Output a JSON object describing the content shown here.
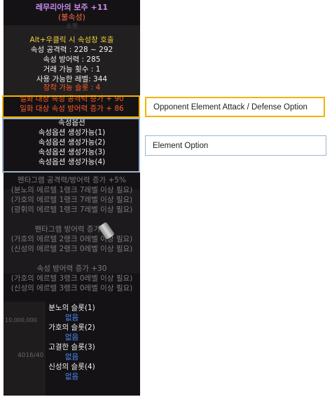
{
  "tooltip": {
    "name": "레무리아의 보주 +11",
    "element": "(불속성)",
    "slot_label": "소켓",
    "hint": "Alt+우클릭 시 속성창 호출",
    "stats": [
      "속성 공격력 : 228 ~ 292",
      "속성 방어력 : 285",
      "거래 가능 횟수 : 1",
      "사용 가능한 레벨: 344"
    ],
    "slot_count": "장착 가능 슬롯 : 4",
    "opponent_options": [
      "일화 대상 속성 공격력 증가 + 90",
      "일화 대상 속성 방어력 증가 + 86"
    ],
    "element_option_header": "속성옵션",
    "element_options": [
      "속성옵션 생성가능(1)",
      "속성옵션 생성가능(2)",
      "속성옵션 생성가능(3)",
      "속성옵션 생성가능(4)"
    ],
    "pentagram_group1": [
      "펜타그램 공격력/방어력 증가 +5%",
      "(분노의 에르텔 1랭크 7레벨 이상 필요)",
      "(가호의 에르텔 1랭크 7레벨 이상 필요)",
      "(광휘의 에르텔 1랭크 7레벨 이상 필요)"
    ],
    "pentagram_group2": [
      "펜타그램 방어력 증가 +",
      "(가호의 에르텔 2랭크 0레벨 이상 필요)",
      "(신성의 에르텔 2랭크 0레벨 이상 필요)"
    ],
    "pentagram_group3": [
      "속성 방어력 증가 +30",
      "(가호의 에르텔 3랭크 0레벨 이상 필요)",
      "(신성의 에르텔 3랭크 0레벨 이상 필요)"
    ],
    "slots": [
      {
        "name": "분노의 슬롯(1)",
        "value": "없음"
      },
      {
        "name": "가호의 슬롯(2)",
        "value": "없음"
      },
      {
        "name": "고결한 슬롯(3)",
        "value": "없음"
      },
      {
        "name": "신성의 슬롯(4)",
        "value": "없음"
      }
    ],
    "background_fragments": [
      "10,000,000",
      "4016/40"
    ]
  },
  "annotations": {
    "opponent_label": "Opponent Element Attack / Defense Option",
    "element_label": "Element Option",
    "opponent_color": "#f0b400",
    "element_color": "#9fb5cf"
  }
}
